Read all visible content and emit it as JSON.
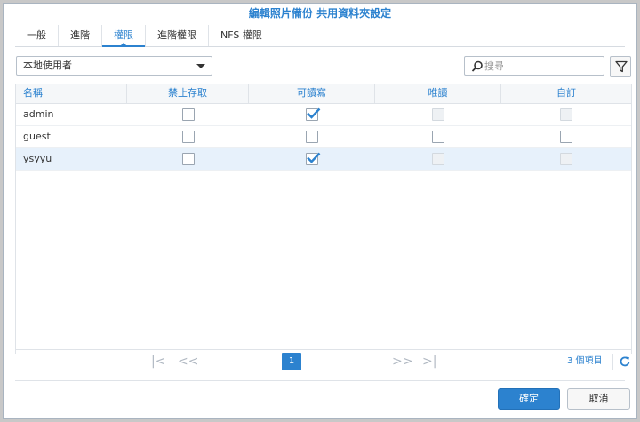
{
  "window": {
    "title": "編輯照片備份 共用資料夾設定"
  },
  "tabs": [
    {
      "label": "一般"
    },
    {
      "label": "進階"
    },
    {
      "label": "權限"
    },
    {
      "label": "進階權限"
    },
    {
      "label": "NFS 權限"
    }
  ],
  "active_tab": "權限",
  "user_type_select": {
    "value": "本地使用者"
  },
  "search": {
    "placeholder": "搜尋"
  },
  "table": {
    "columns": [
      "名稱",
      "禁止存取",
      "可讀寫",
      "唯讀",
      "自訂"
    ],
    "rows": [
      {
        "name": "admin",
        "deny": false,
        "read_write": true,
        "read_only": false,
        "custom": false,
        "read_only_disabled": true,
        "custom_disabled": true
      },
      {
        "name": "guest",
        "deny": false,
        "read_write": false,
        "read_only": false,
        "custom": false,
        "read_only_disabled": false,
        "custom_disabled": false
      },
      {
        "name": "ysyyu",
        "deny": false,
        "read_write": true,
        "read_only": false,
        "custom": false,
        "read_only_disabled": true,
        "custom_disabled": true
      }
    ],
    "selected_row": "ysyyu"
  },
  "pager": {
    "first": "|<",
    "prev": "<<",
    "current_page": "1",
    "next": ">>",
    "last": ">|",
    "item_count": "3 個項目"
  },
  "footer": {
    "ok_label": "確定",
    "cancel_label": "取消"
  },
  "colors": {
    "accent": "#2c82cf",
    "selected_row": "#e7f1fb"
  },
  "icons": {
    "search": "search-icon",
    "filter": "filter-icon",
    "refresh": "refresh-icon",
    "check": "checkmark-icon"
  }
}
